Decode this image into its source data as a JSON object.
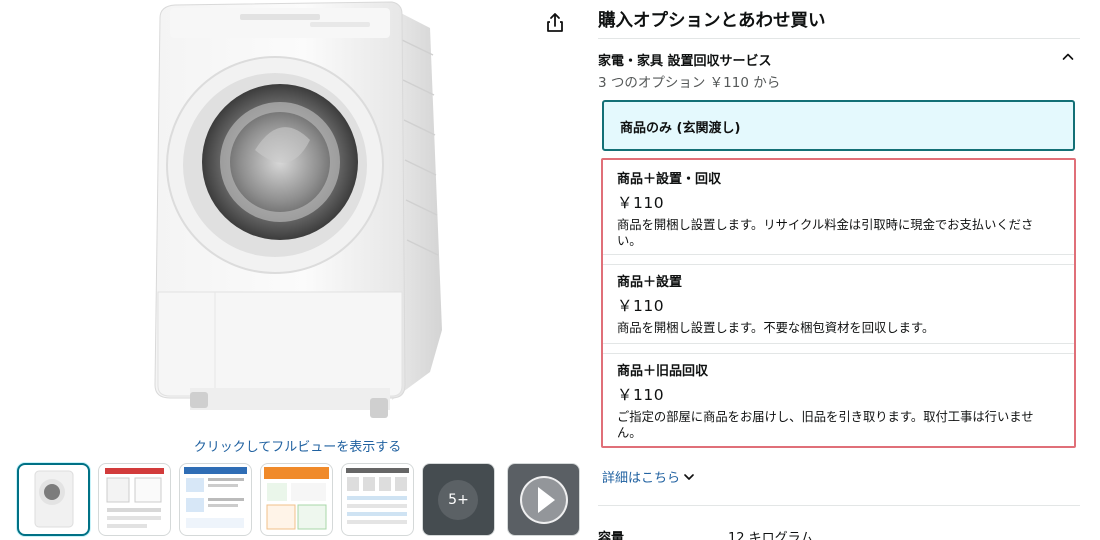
{
  "gallery": {
    "fullview_link": "クリックしてフルビューを表示する",
    "thumbnails": [
      {
        "kind": "washer-photo",
        "selected": true
      },
      {
        "kind": "dimension-diagram",
        "selected": false
      },
      {
        "kind": "service-info",
        "selected": false
      },
      {
        "kind": "feature-sheet",
        "selected": false
      },
      {
        "kind": "feature-grid",
        "selected": false
      },
      {
        "kind": "more",
        "overlay": "5+",
        "selected": false
      },
      {
        "kind": "video",
        "selected": false
      }
    ],
    "share_icon": "share-icon"
  },
  "buying": {
    "title": "購入オプションとあわせ買い",
    "service": {
      "name": "家電・家具 設置回収サービス",
      "summary": "3 つのオプション ￥110 から",
      "toggle_icon": "chevron-up-icon"
    },
    "selected_option": {
      "label": "商品のみ (玄関渡し)"
    },
    "options": [
      {
        "name": "商品＋設置・回収",
        "price": "￥110",
        "description": "商品を開梱し設置します。リサイクル料金は引取時に現金でお支払いくださ い。"
      },
      {
        "name": "商品＋設置",
        "price": "￥110",
        "description": "商品を開梱し設置します。不要な梱包資材を回収します。"
      },
      {
        "name": "商品＋旧品回収",
        "price": "￥110",
        "description": "ご指定の部屋に商品をお届けし、旧品を引き取ります。取付工事は行いませ ん。"
      }
    ],
    "details_link": "詳細はこちら",
    "colors": {
      "selected_border": "#137076",
      "selected_bg": "#e4f9fd",
      "group_border": "#e06f78",
      "link": "#2162a1"
    }
  },
  "spec": {
    "label": "容量",
    "value": "12 キログラム"
  }
}
